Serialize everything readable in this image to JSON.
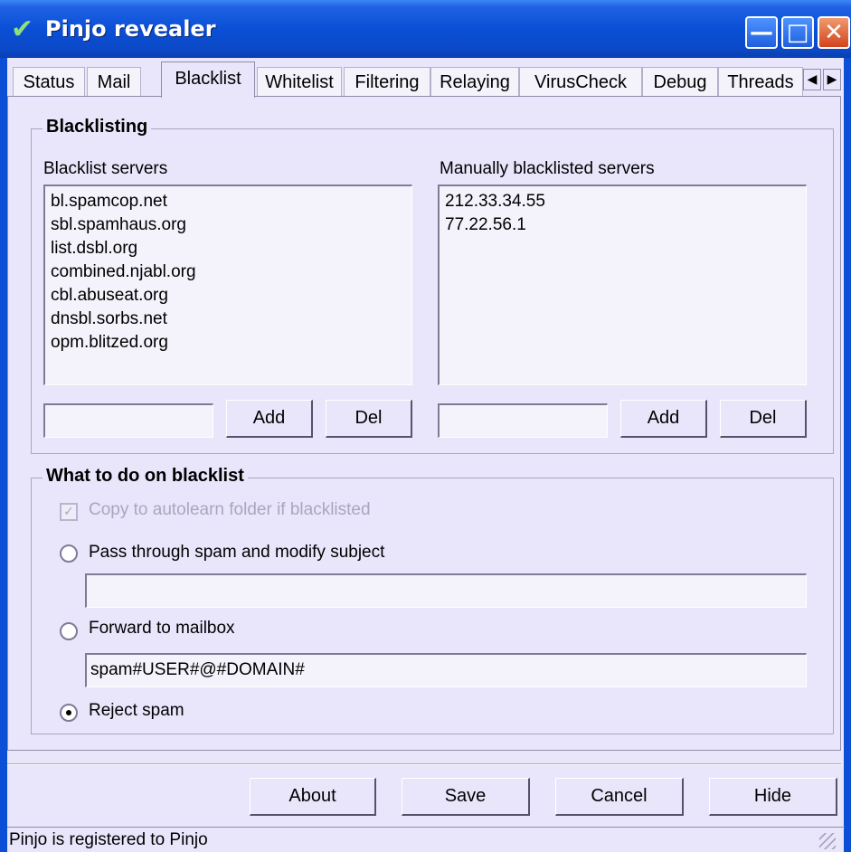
{
  "window": {
    "title": "Pinjo revealer"
  },
  "tabs": [
    {
      "label": "Status"
    },
    {
      "label": "Mail"
    },
    {
      "label": "Blacklist"
    },
    {
      "label": "Whitelist"
    },
    {
      "label": "Filtering"
    },
    {
      "label": "Relaying"
    },
    {
      "label": "VirusCheck"
    },
    {
      "label": "Debug"
    },
    {
      "label": "Threads"
    }
  ],
  "blacklisting": {
    "group_title": "Blacklisting",
    "servers_label": "Blacklist servers",
    "servers": [
      "bl.spamcop.net",
      "sbl.spamhaus.org",
      "list.dsbl.org",
      "combined.njabl.org",
      "cbl.abuseat.org",
      "dnsbl.sorbs.net",
      "opm.blitzed.org"
    ],
    "servers_input": "",
    "manual_label": "Manually blacklisted servers",
    "manual": [
      "212.33.34.55",
      "77.22.56.1"
    ],
    "manual_input": "",
    "add_label": "Add",
    "del_label": "Del"
  },
  "action": {
    "group_title": "What to do on blacklist",
    "copy_label": "Copy to autolearn folder if blacklisted",
    "pass_label": "Pass through spam and modify subject",
    "pass_value": "",
    "forward_label": "Forward to mailbox",
    "forward_value": "spam#USER#@#DOMAIN#",
    "reject_label": "Reject spam"
  },
  "buttons": {
    "about": "About",
    "save": "Save",
    "cancel": "Cancel",
    "hide": "Hide"
  },
  "status": {
    "text": "Pinjo is registered to Pinjo"
  }
}
